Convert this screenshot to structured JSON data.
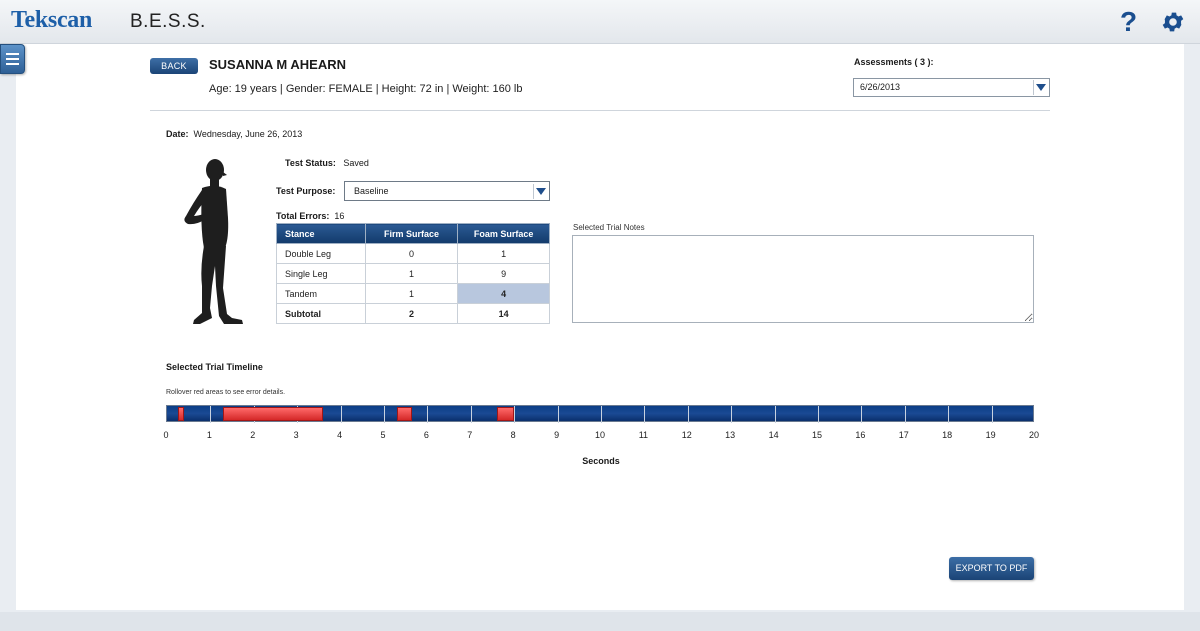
{
  "header": {
    "logo": "Tekscan",
    "app_title": "B.E.S.S.",
    "help_icon": "question-mark-icon",
    "settings_icon": "gear-icon"
  },
  "sidebar": {
    "toggle_icon": "hamburger-menu-icon"
  },
  "patient": {
    "back_label": "BACK",
    "name": "SUSANNA M AHEARN",
    "info": "Age: 19 years | Gender: FEMALE | Height: 72 in | Weight: 160 lb"
  },
  "assessments": {
    "label": "Assessments ( 3 ):",
    "selected": "6/26/2013"
  },
  "test": {
    "date_label": "Date:",
    "date_value": "Wednesday, June 26, 2013",
    "status_label": "Test Status:",
    "status_value": "Saved",
    "purpose_label": "Test Purpose:",
    "purpose_value": "Baseline",
    "errors_label": "Total Errors:",
    "errors_value": "16"
  },
  "error_table": {
    "headers": [
      "Stance",
      "Firm Surface",
      "Foam Surface"
    ],
    "rows": [
      [
        "Double Leg",
        "0",
        "1"
      ],
      [
        "Single Leg",
        "1",
        "9"
      ],
      [
        "Tandem",
        "1",
        "4"
      ]
    ],
    "subtotal": [
      "Subtotal",
      "2",
      "14"
    ]
  },
  "notes": {
    "label": "Selected Trial Notes",
    "value": ""
  },
  "timeline": {
    "title": "Selected Trial Timeline",
    "hint": "Rollover red areas to see error details.",
    "axis_label": "Seconds",
    "ticks": [
      "0",
      "1",
      "2",
      "3",
      "4",
      "5",
      "6",
      "7",
      "8",
      "9",
      "10",
      "11",
      "12",
      "13",
      "14",
      "15",
      "16",
      "17",
      "18",
      "19",
      "20"
    ],
    "duration_seconds": 20,
    "error_segments_seconds": [
      [
        0.25,
        0.4
      ],
      [
        1.3,
        3.6
      ],
      [
        5.3,
        5.65
      ],
      [
        7.6,
        8.0
      ]
    ],
    "colors": {
      "bar": "#0b3d86",
      "error": "#e03030"
    }
  },
  "actions": {
    "export_label": "EXPORT TO PDF"
  },
  "colors": {
    "brand": "#1d5fa8",
    "accent": "#1b4476",
    "selected_cell": "#b8c7de"
  }
}
